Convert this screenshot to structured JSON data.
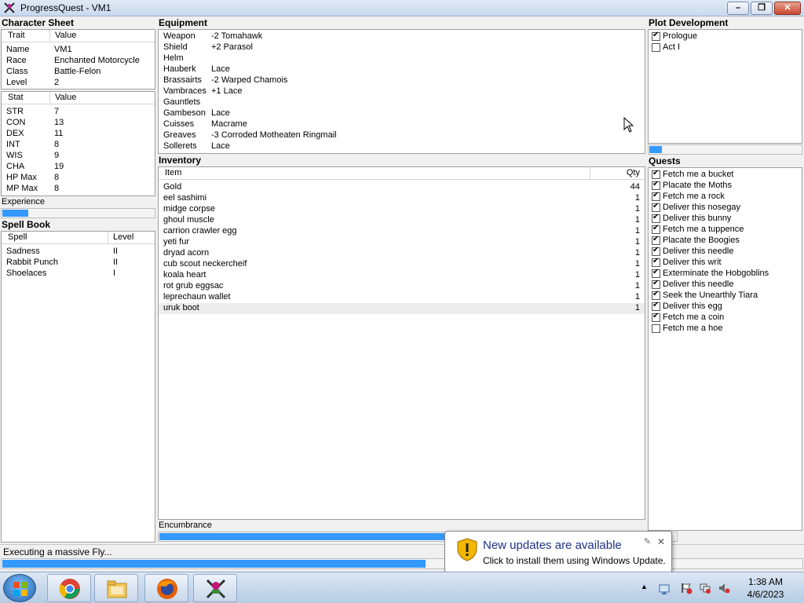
{
  "window": {
    "title": "ProgressQuest - VM1",
    "min_label": "–",
    "max_label": "❐",
    "close_label": "✕"
  },
  "character_sheet": {
    "title": "Character Sheet",
    "trait_header": "Trait",
    "value_header": "Value",
    "traits": [
      {
        "label": "Name",
        "value": "VM1"
      },
      {
        "label": "Race",
        "value": "Enchanted Motorcycle"
      },
      {
        "label": "Class",
        "value": "Battle-Felon"
      },
      {
        "label": "Level",
        "value": "2"
      }
    ],
    "stat_header": "Stat",
    "stat_value_header": "Value",
    "stats": [
      {
        "label": "STR",
        "value": "7"
      },
      {
        "label": "CON",
        "value": "13"
      },
      {
        "label": "DEX",
        "value": "11"
      },
      {
        "label": "INT",
        "value": "8"
      },
      {
        "label": "WIS",
        "value": "9"
      },
      {
        "label": "CHA",
        "value": "19"
      },
      {
        "label": "HP Max",
        "value": "8"
      },
      {
        "label": "MP Max",
        "value": "8"
      }
    ],
    "experience_label": "Experience",
    "experience_progress": 0.18
  },
  "spell_book": {
    "title": "Spell Book",
    "spell_header": "Spell",
    "level_header": "Level",
    "spells": [
      {
        "name": "Sadness",
        "level": "II"
      },
      {
        "name": "Rabbit Punch",
        "level": "II"
      },
      {
        "name": "Shoelaces",
        "level": "I"
      }
    ]
  },
  "equipment": {
    "title": "Equipment",
    "items": [
      {
        "slot": "Weapon",
        "item": "-2 Tomahawk"
      },
      {
        "slot": "Shield",
        "item": "+2 Parasol"
      },
      {
        "slot": "Helm",
        "item": ""
      },
      {
        "slot": "Hauberk",
        "item": "Lace"
      },
      {
        "slot": "Brassairts",
        "item": "-2 Warped Chamois"
      },
      {
        "slot": "Vambraces",
        "item": "+1 Lace"
      },
      {
        "slot": "Gauntlets",
        "item": ""
      },
      {
        "slot": "Gambeson",
        "item": "Lace"
      },
      {
        "slot": "Cuisses",
        "item": "Macrame"
      },
      {
        "slot": "Greaves",
        "item": "-3 Corroded Motheaten Ringmail"
      },
      {
        "slot": "Sollerets",
        "item": "Lace"
      }
    ]
  },
  "inventory": {
    "title": "Inventory",
    "item_header": "Item",
    "qty_header": "Qty",
    "items": [
      {
        "name": "Gold",
        "qty": "44"
      },
      {
        "name": "eel sashimi",
        "qty": "1"
      },
      {
        "name": "midge corpse",
        "qty": "1"
      },
      {
        "name": "ghoul muscle",
        "qty": "1"
      },
      {
        "name": "carrion crawler egg",
        "qty": "1"
      },
      {
        "name": "yeti fur",
        "qty": "1"
      },
      {
        "name": "dryad acorn",
        "qty": "1"
      },
      {
        "name": "cub scout neckercheif",
        "qty": "1"
      },
      {
        "name": "koala heart",
        "qty": "1"
      },
      {
        "name": "rot grub eggsac",
        "qty": "1"
      },
      {
        "name": "leprechaun wallet",
        "qty": "1"
      },
      {
        "name": "uruk boot",
        "qty": "1"
      }
    ],
    "encumbrance_label": "Encumbrance",
    "encumbrance_progress": 0.92
  },
  "plot": {
    "title": "Plot Development",
    "acts": [
      {
        "label": "Prologue",
        "checked": true
      },
      {
        "label": "Act I",
        "checked": false
      }
    ],
    "progress": 0.09
  },
  "quests": {
    "title": "Quests",
    "items": [
      {
        "label": "Fetch me a bucket",
        "checked": true
      },
      {
        "label": "Placate the Moths",
        "checked": true
      },
      {
        "label": "Fetch me a rock",
        "checked": true
      },
      {
        "label": "Deliver this nosegay",
        "checked": true
      },
      {
        "label": "Deliver this bunny",
        "checked": true
      },
      {
        "label": "Fetch me a tuppence",
        "checked": true
      },
      {
        "label": "Placate the Boogies",
        "checked": true
      },
      {
        "label": "Deliver this needle",
        "checked": true
      },
      {
        "label": "Deliver this writ",
        "checked": true
      },
      {
        "label": "Exterminate the Hobgoblins",
        "checked": true
      },
      {
        "label": "Deliver this needle",
        "checked": true
      },
      {
        "label": "Seek the Unearthly Tiara",
        "checked": true
      },
      {
        "label": "Deliver this egg",
        "checked": true
      },
      {
        "label": "Fetch me a coin",
        "checked": true
      },
      {
        "label": "Fetch me a hoe",
        "checked": false
      }
    ],
    "progress": 0.97
  },
  "status": {
    "text": "Executing a massive Fly...",
    "progress": 0.53
  },
  "notification": {
    "title": "New updates are available",
    "text": "Click to install them using Windows Update.",
    "close_label": "✕",
    "options_label": "✎"
  },
  "taskbar": {
    "apps": [
      "chrome-icon",
      "explorer-icon",
      "firefox-icon",
      "progressquest-icon"
    ],
    "time": "1:38 AM",
    "date": "4/6/2023"
  },
  "colors": {
    "progress_fill": "#3399ff",
    "accent": "#1e3287"
  }
}
